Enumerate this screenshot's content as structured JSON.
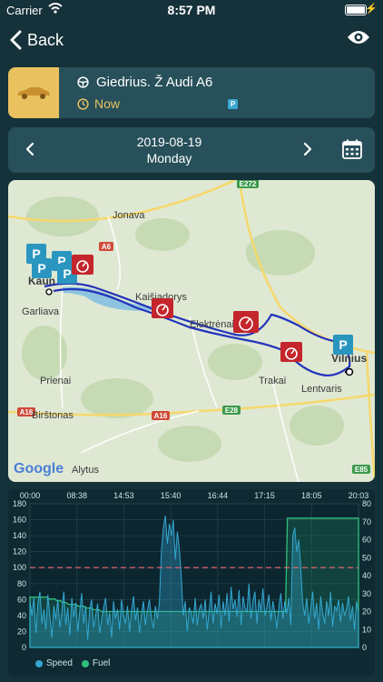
{
  "status_bar": {
    "carrier": "Carrier",
    "time": "8:57 PM"
  },
  "nav": {
    "back_label": "Back"
  },
  "vehicle": {
    "name": "Giedrius. Ž Audi A6",
    "status": "Now",
    "parking_badge": "P"
  },
  "date": {
    "date": "2019-08-19",
    "weekday": "Monday"
  },
  "map": {
    "attribution": "Google",
    "roads": [
      "E272",
      "A6",
      "E28",
      "A16",
      "E85"
    ],
    "places": [
      "Jonava",
      "Kaišiadorys",
      "Elektrėnai",
      "Garliava",
      "Prienai",
      "Birštonas",
      "Trakai",
      "Lentvaris",
      "Alytus",
      "Vilnius",
      "Kaun"
    ]
  },
  "chart_data": {
    "type": "line",
    "x_ticks": [
      "00:00",
      "08:38",
      "14:53",
      "15:40",
      "16:44",
      "17:15",
      "18:05",
      "20:03"
    ],
    "y_left_ticks": [
      "0",
      "20",
      "40",
      "60",
      "80",
      "100",
      "120",
      "140",
      "160",
      "180"
    ],
    "y_right_ticks": [
      "0",
      "10",
      "20",
      "30",
      "40",
      "50",
      "60",
      "70",
      "80"
    ],
    "ylim_left": [
      0,
      180
    ],
    "ylim_right": [
      0,
      80
    ],
    "speed_limit": 100,
    "series": [
      {
        "name": "Speed",
        "color": "#34a7d0",
        "values": [
          58,
          40,
          62,
          18,
          55,
          70,
          30,
          48,
          22,
          66,
          40,
          12,
          52,
          35,
          60,
          25,
          44,
          70,
          28,
          50,
          15,
          62,
          38,
          56,
          20,
          45,
          68,
          30,
          52,
          10,
          48,
          60,
          25,
          40,
          55,
          18,
          35,
          50,
          62,
          28,
          44,
          12,
          58,
          36,
          48,
          22,
          60,
          40,
          30,
          52,
          20,
          46,
          64,
          34,
          50,
          18,
          42,
          58,
          28,
          46,
          60,
          38,
          24,
          52,
          36,
          56,
          120,
          150,
          165,
          130,
          155,
          140,
          160,
          110,
          145,
          125,
          90,
          40,
          58,
          20,
          50,
          44,
          30,
          62,
          28,
          48,
          54,
          36,
          60,
          22,
          46,
          70,
          30,
          55,
          42,
          66,
          24,
          58,
          40,
          68,
          32,
          76,
          48,
          60,
          38,
          72,
          28,
          64,
          50,
          44,
          80,
          36,
          58,
          70,
          30,
          60,
          46,
          74,
          40,
          52,
          66,
          34,
          58,
          44,
          24,
          50,
          68,
          36,
          58,
          42,
          62,
          28,
          140,
          150,
          120,
          135,
          100,
          55,
          40,
          62,
          30,
          48,
          70,
          36,
          56,
          22,
          64,
          44,
          30,
          58,
          40,
          70,
          26,
          52,
          46,
          60,
          32,
          56,
          40,
          48,
          64,
          34,
          52,
          22,
          58,
          44
        ]
      },
      {
        "name": "Fuel",
        "color": "#2fc07c",
        "values": [
          28,
          28,
          28,
          28,
          28,
          28,
          28,
          28,
          28,
          28,
          27,
          27,
          27,
          27,
          26,
          26,
          26,
          25,
          25,
          25,
          24,
          24,
          24,
          24,
          24,
          23,
          23,
          23,
          23,
          22,
          22,
          22,
          22,
          21,
          21,
          21,
          21,
          20,
          20,
          20,
          20,
          20,
          20,
          20,
          20,
          20,
          20,
          20,
          20,
          20,
          20,
          20,
          20,
          20,
          20,
          20,
          20,
          20,
          20,
          20,
          20,
          20,
          20,
          20,
          20,
          20,
          20,
          20,
          20,
          20,
          20,
          20,
          20,
          20,
          20,
          20,
          20,
          20,
          20,
          20,
          20,
          20,
          20,
          20,
          20,
          20,
          20,
          20,
          20,
          20,
          20,
          20,
          20,
          20,
          20,
          20,
          20,
          20,
          20,
          20,
          20,
          20,
          20,
          20,
          20,
          20,
          20,
          20,
          20,
          20,
          20,
          20,
          20,
          20,
          20,
          20,
          20,
          20,
          20,
          20,
          20,
          20,
          20,
          20,
          20,
          20,
          20,
          20,
          20,
          20,
          20,
          20,
          20,
          20,
          20,
          20,
          20,
          20,
          20,
          20,
          20,
          20,
          20,
          20,
          20,
          20,
          20,
          20,
          20,
          20,
          20,
          20,
          20,
          20,
          20,
          20,
          20,
          20,
          20,
          20,
          20,
          20,
          20,
          20,
          20,
          20,
          20,
          20,
          20,
          20,
          20,
          20
        ]
      }
    ],
    "fuel_step": {
      "from_fraction": 0.78,
      "value": 72
    },
    "legend_placement": "bottom-left"
  }
}
